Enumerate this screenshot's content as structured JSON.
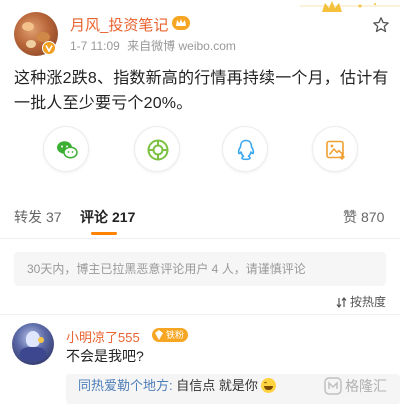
{
  "post": {
    "user_name": "月风_投资笔记",
    "time": "1-7 11:09",
    "source": "来自微博 weibo.com",
    "text": "这种涨2跌8、指数新高的行情再持续一个月，估计有一批人至少要亏个20%。"
  },
  "share_buttons": [
    {
      "icon": "wechat-icon"
    },
    {
      "icon": "moments-icon"
    },
    {
      "icon": "qq-icon"
    },
    {
      "icon": "save-image-icon"
    }
  ],
  "tabs": {
    "repost": {
      "label": "转发",
      "count": "37"
    },
    "comment": {
      "label": "评论",
      "count": "217"
    },
    "like": {
      "label": "赞",
      "count": "870"
    }
  },
  "notice": "30天内，博主已拉黑恶意评论用户 4 人，请谨慎评论",
  "sort_label": "按热度",
  "comment": {
    "user_name": "小明凉了555",
    "badge": "铁粉",
    "text": "不会是我吧?",
    "reply_user": "同热爱勒个地方:",
    "reply_text": " 自信点 就是你"
  },
  "watermark": "格隆汇",
  "colors": {
    "username": "#e8632f",
    "accent": "#ff8200",
    "link": "#4d7eb8",
    "wechat": "#3cb034",
    "moments": "#7cc142",
    "qq": "#3ba8f0",
    "save": "#f0a030"
  }
}
